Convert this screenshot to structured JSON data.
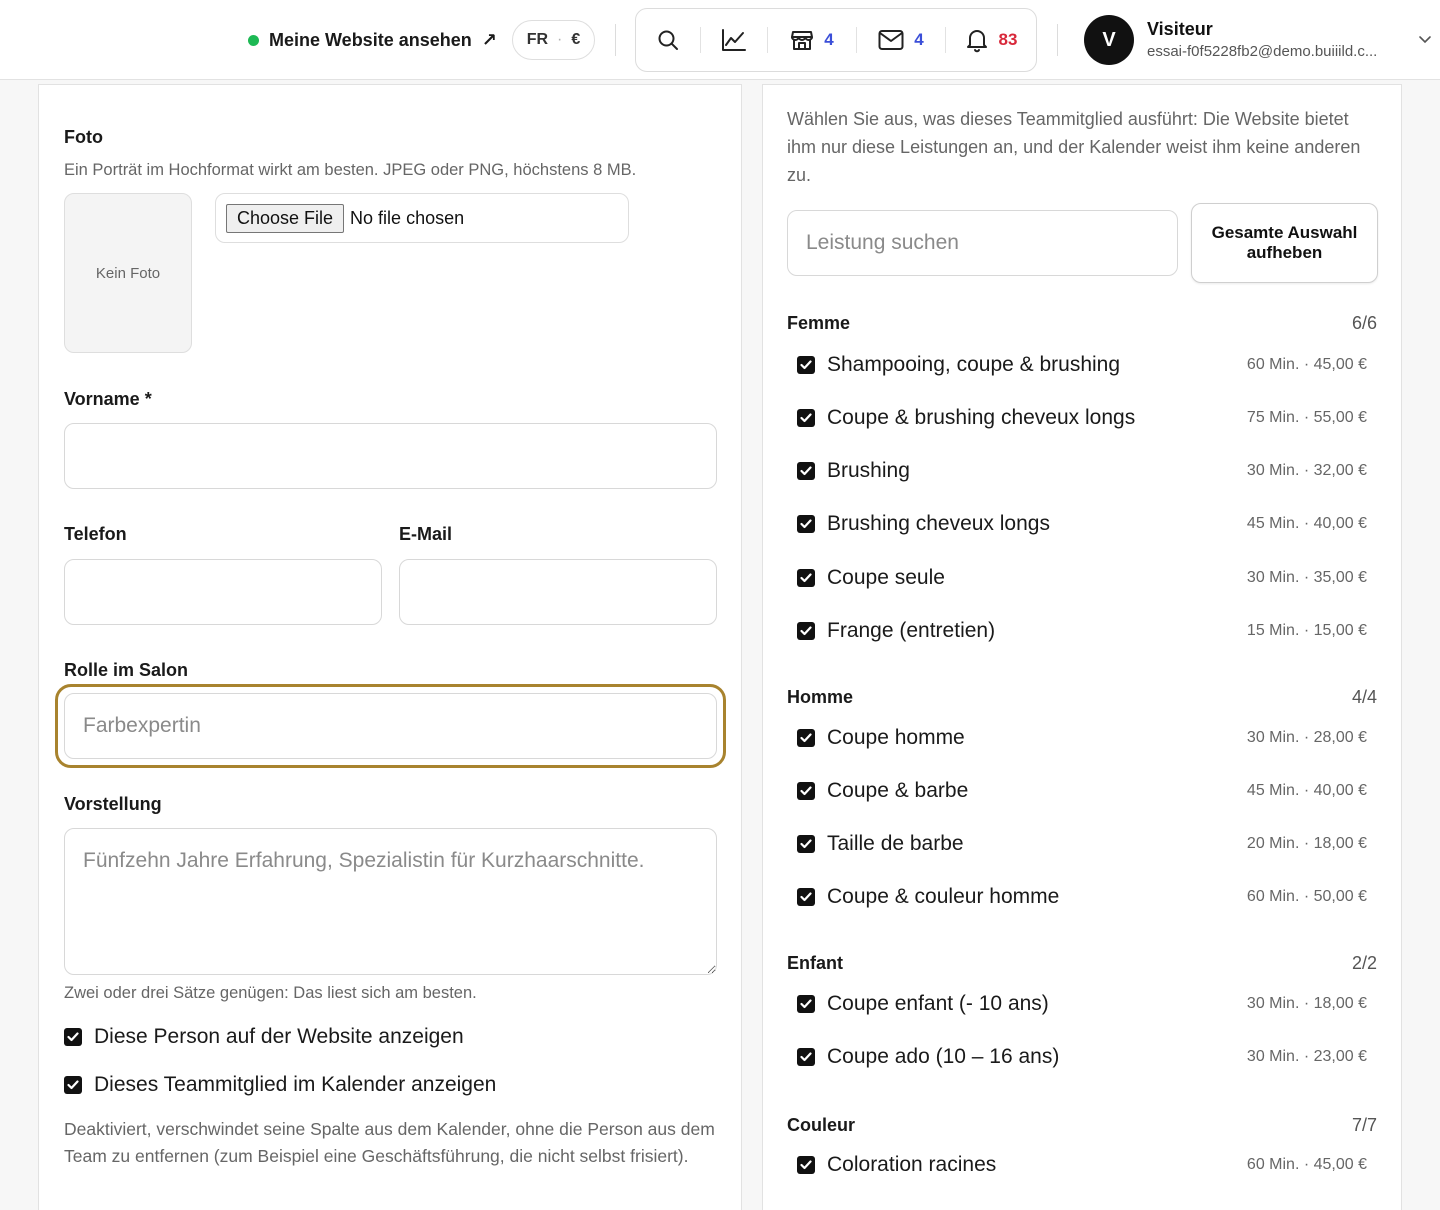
{
  "topbar": {
    "site_link": "Meine Website ansehen",
    "site_link_arrow": "↗",
    "lang": "FR",
    "lang_sep": "·",
    "currency": "€",
    "icons": {
      "search": "search-icon",
      "stats": "chart-line-icon",
      "store": "store-icon",
      "mail": "mail-icon",
      "bell": "bell-icon"
    },
    "store_count": "4",
    "mail_count": "4",
    "bell_count": "83",
    "user_initial": "V",
    "user_name": "Visiteur",
    "user_email": "essai-f0f5228fb2@demo.buiiild.c..."
  },
  "form": {
    "photo_label": "Foto",
    "photo_help": "Ein Porträt im Hochformat wirkt am besten. JPEG oder PNG, höchstens 8 MB.",
    "photo_placeholder": "Kein Foto",
    "file_button": "Choose File",
    "file_status": "No file chosen",
    "firstname_label": "Vorname *",
    "firstname_value": "",
    "phone_label": "Telefon",
    "phone_value": "",
    "email_label": "E-Mail",
    "email_value": "",
    "role_label": "Rolle im Salon",
    "role_placeholder": "Farbexpertin",
    "intro_label": "Vorstellung",
    "intro_placeholder": "Fünfzehn Jahre Erfahrung, Spezialistin für Kurzhaarschnitte.",
    "intro_help": "Zwei oder drei Sätze genügen: Das liest sich am besten.",
    "show_website_label": "Diese Person auf der Website anzeigen",
    "show_website_checked": true,
    "show_calendar_label": "Dieses Teammitglied im Kalender anzeigen",
    "show_calendar_checked": true,
    "calendar_help": "Deaktiviert, verschwindet seine Spalte aus dem Kalender, ohne die Person aus dem Team zu entfernen (zum Beispiel eine Geschäftsführung, die nicht selbst frisiert)."
  },
  "services": {
    "intro": "Wählen Sie aus, was dieses Teammitglied ausführt: Die Website bietet ihm nur diese Leistungen an, und der Kalender weist ihm keine anderen zu.",
    "search_placeholder": "Leistung suchen",
    "clear_button": "Gesamte Auswahl aufheben",
    "categories": [
      {
        "name": "Femme",
        "count": "6/6",
        "items": [
          {
            "name": "Shampooing, coupe & brushing",
            "meta": "60 Min. · 45,00 €",
            "checked": true
          },
          {
            "name": "Coupe & brushing cheveux longs",
            "meta": "75 Min. · 55,00 €",
            "checked": true
          },
          {
            "name": "Brushing",
            "meta": "30 Min. · 32,00 €",
            "checked": true
          },
          {
            "name": "Brushing cheveux longs",
            "meta": "45 Min. · 40,00 €",
            "checked": true
          },
          {
            "name": "Coupe seule",
            "meta": "30 Min. · 35,00 €",
            "checked": true
          },
          {
            "name": "Frange (entretien)",
            "meta": "15 Min. · 15,00 €",
            "checked": true
          }
        ]
      },
      {
        "name": "Homme",
        "count": "4/4",
        "items": [
          {
            "name": "Coupe homme",
            "meta": "30 Min. · 28,00 €",
            "checked": true
          },
          {
            "name": "Coupe & barbe",
            "meta": "45 Min. · 40,00 €",
            "checked": true
          },
          {
            "name": "Taille de barbe",
            "meta": "20 Min. · 18,00 €",
            "checked": true
          },
          {
            "name": "Coupe & couleur homme",
            "meta": "60 Min. · 50,00 €",
            "checked": true
          }
        ]
      },
      {
        "name": "Enfant",
        "count": "2/2",
        "items": [
          {
            "name": "Coupe enfant (- 10 ans)",
            "meta": "30 Min. · 18,00 €",
            "checked": true
          },
          {
            "name": "Coupe ado (10 – 16 ans)",
            "meta": "30 Min. · 23,00 €",
            "checked": true
          }
        ]
      },
      {
        "name": "Couleur",
        "count": "7/7",
        "items": [
          {
            "name": "Coloration racines",
            "meta": "60 Min. · 45,00 €",
            "checked": true
          }
        ]
      }
    ]
  },
  "colors": {
    "accent_focus": "#a8832e",
    "status_green": "#1db954",
    "count_blue": "#3b4fd8",
    "count_red": "#d8283a"
  }
}
